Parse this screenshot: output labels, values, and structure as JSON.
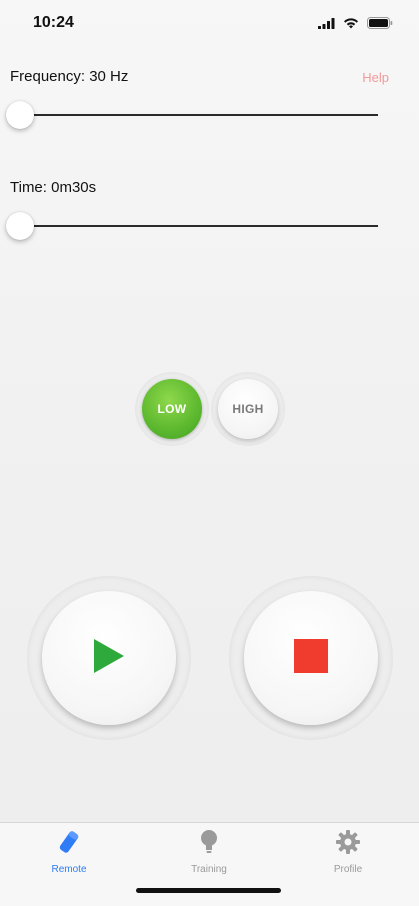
{
  "status_bar": {
    "time": "10:24",
    "icons": [
      "signal-icon",
      "wifi-icon",
      "battery-icon"
    ]
  },
  "header": {
    "frequency_label": "Frequency: 30 Hz",
    "help_label": "Help",
    "help_color": "#f29a9a"
  },
  "frequency_slider": {
    "value": 0.0
  },
  "time_label": "Time: 0m30s",
  "time_slider": {
    "value": 0.0
  },
  "mode": {
    "selected": "LOW",
    "low_label": "LOW",
    "high_label": "HIGH",
    "low_color": "#5cb82e"
  },
  "controls": {
    "play_icon": "play-icon",
    "play_color": "#2eaa3d",
    "stop_icon": "stop-icon",
    "stop_color": "#f03b2f"
  },
  "tab_bar": {
    "active": "Remote",
    "active_color": "#2f7cf6",
    "tabs": [
      {
        "label": "Remote",
        "icon": "remote-icon"
      },
      {
        "label": "Training",
        "icon": "lightbulb-icon"
      },
      {
        "label": "Profile",
        "icon": "gear-icon"
      }
    ]
  }
}
